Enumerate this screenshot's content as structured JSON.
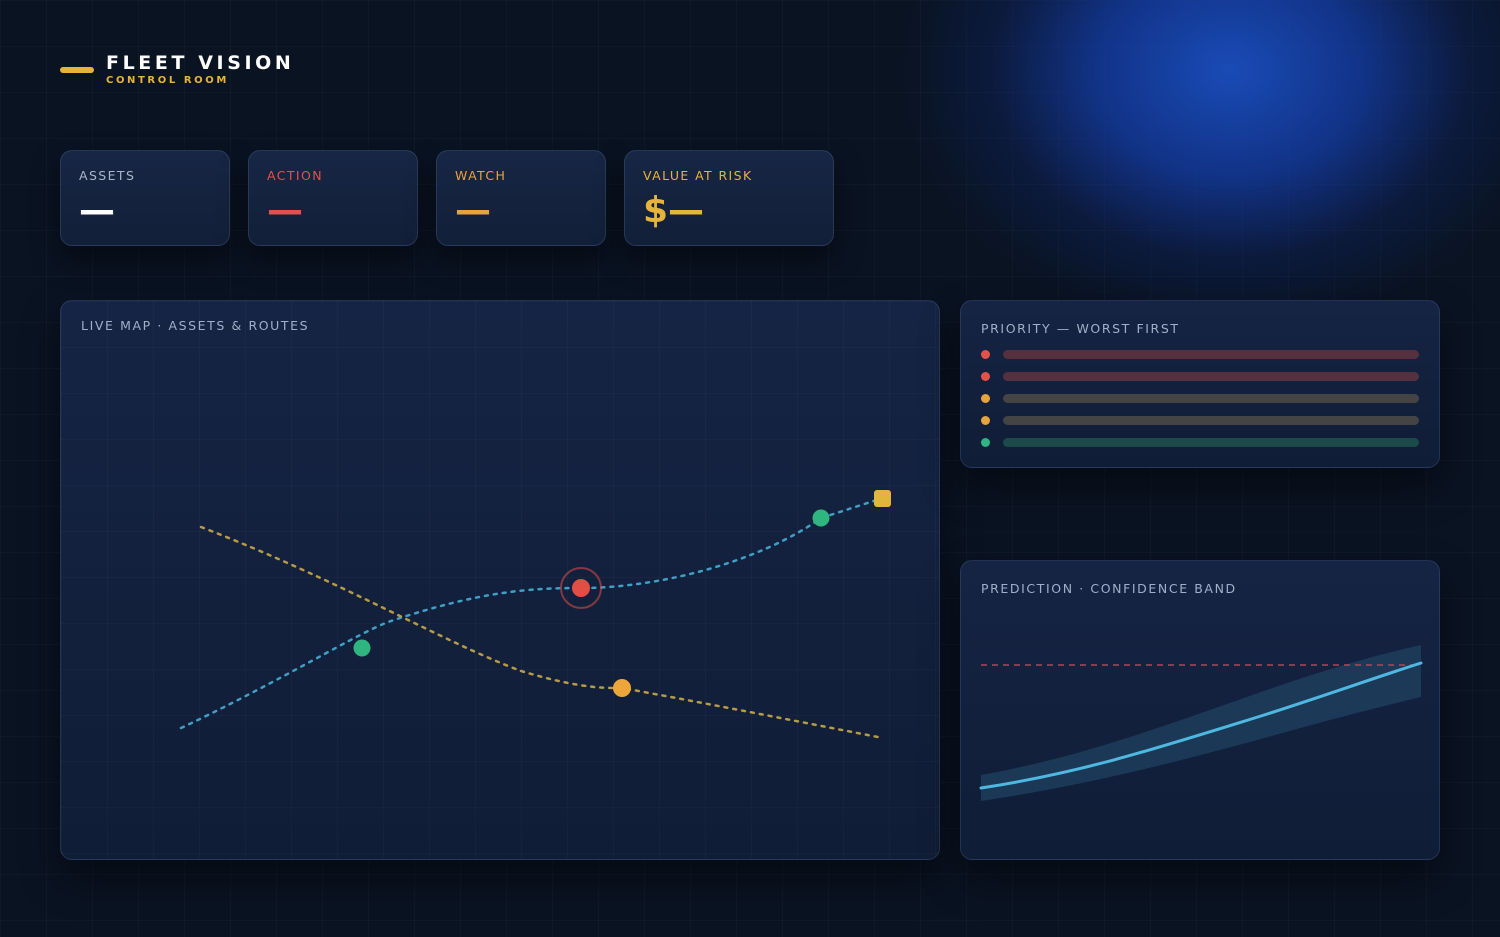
{
  "header": {
    "title": "FLEET VISION",
    "subtitle": "CONTROL ROOM",
    "accent": "#e6b43a"
  },
  "kpis": [
    {
      "label": "ASSETS",
      "value": "—",
      "color": "#ffffff",
      "label_color": "#a9b6c9"
    },
    {
      "label": "ACTION",
      "value": "—",
      "color": "#e2524a",
      "label_color": "#e2524a"
    },
    {
      "label": "WATCH",
      "value": "—",
      "color": "#e8a43c",
      "label_color": "#e8a43c"
    },
    {
      "label": "VALUE AT RISK",
      "value": "$—",
      "color": "#e6b43a",
      "label_color": "#e6b43a"
    }
  ],
  "map": {
    "title": "LIVE MAP · ASSETS & ROUTES",
    "route_colors": [
      "#3f9fc4",
      "#b69a46"
    ],
    "asset_colors": {
      "ok": "#2fb57f",
      "alert": "#e24d44",
      "watch": "#eea63b",
      "destination": "#e2b63a"
    }
  },
  "priority": {
    "title": "PRIORITY — WORST FIRST",
    "items": [
      {
        "status": "action",
        "color": "#e2524a",
        "bar_color": "#55303f"
      },
      {
        "status": "action",
        "color": "#e2524a",
        "bar_color": "#55303f"
      },
      {
        "status": "watch",
        "color": "#e8a43c",
        "bar_color": "#444444"
      },
      {
        "status": "watch",
        "color": "#e8a43c",
        "bar_color": "#444444"
      },
      {
        "status": "ok",
        "color": "#2fb57f",
        "bar_color": "#1c4a4a"
      }
    ]
  },
  "prediction": {
    "title": "PREDICTION · CONFIDENCE BAND",
    "line_color": "#4fb8e0",
    "band_color": "#1c3b58",
    "threshold_color": "#b0475a"
  }
}
